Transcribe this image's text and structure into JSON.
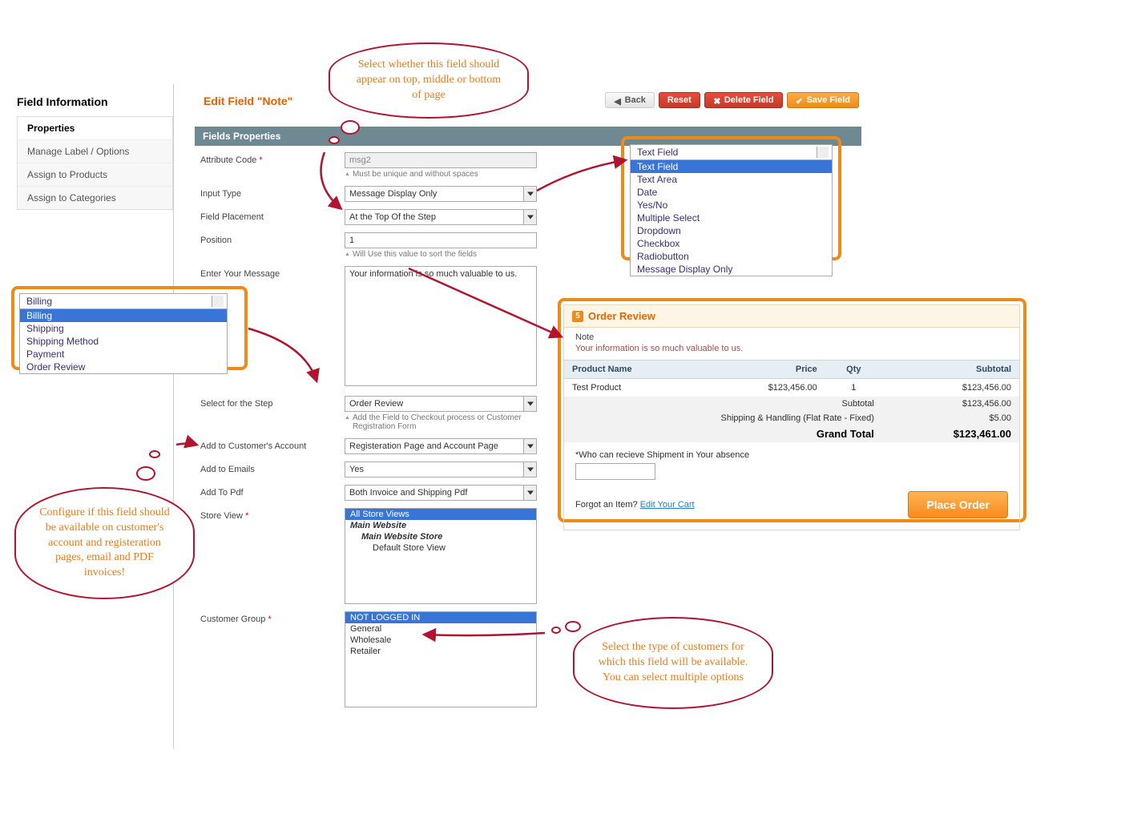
{
  "sidebar": {
    "title": "Field Information",
    "items": [
      {
        "label": "Properties",
        "active": true
      },
      {
        "label": "Manage Label / Options"
      },
      {
        "label": "Assign to Products"
      },
      {
        "label": "Assign to Categories"
      }
    ]
  },
  "page": {
    "title": "Edit Field \"Note\""
  },
  "toolbar": {
    "back": "Back",
    "reset": "Reset",
    "delete": "Delete Field",
    "save": "Save Field"
  },
  "panel": {
    "title": "Fields Properties"
  },
  "form": {
    "attribute_code": {
      "label": "Attribute Code",
      "value": "msg2",
      "hint": "Must be unique and without spaces"
    },
    "input_type": {
      "label": "Input Type",
      "value": "Message Display Only"
    },
    "field_placement": {
      "label": "Field Placement",
      "value": "At the Top Of the Step"
    },
    "position": {
      "label": "Position",
      "value": "1",
      "hint": "Will Use this value to sort the fields"
    },
    "message": {
      "label": "Enter Your Message",
      "value": "Your information is so much valuable to us."
    },
    "select_step": {
      "label": "Select for the Step",
      "value": "Order Review",
      "hint": "Add the Field to Checkout process or Customer Registration Form"
    },
    "add_account": {
      "label": "Add to Customer's Account",
      "value": "Registeration Page and Account Page"
    },
    "add_emails": {
      "label": "Add to Emails",
      "value": "Yes"
    },
    "add_pdf": {
      "label": "Add To Pdf",
      "value": "Both Invoice and Shipping Pdf"
    },
    "store_view": {
      "label": "Store View",
      "options": [
        {
          "label": "All Store Views",
          "selected": true
        },
        {
          "label": "Main Website",
          "level": 1
        },
        {
          "label": "Main Website Store",
          "level": 2
        },
        {
          "label": "Default Store View",
          "level": 3
        }
      ]
    },
    "customer_group": {
      "label": "Customer Group",
      "options": [
        {
          "label": "NOT LOGGED IN",
          "selected": true
        },
        {
          "label": "General"
        },
        {
          "label": "Wholesale"
        },
        {
          "label": "Retailer"
        }
      ]
    }
  },
  "callouts": {
    "placement": "Select whether this field should appear on top, middle or bottom of page",
    "account": "Configure if this field should be available on customer's account and registeration pages, email and PDF invoices!",
    "group": "Select the type of customers for which this field will be available. You can select multiple options"
  },
  "input_type_popup": {
    "head": "Text Field",
    "options": [
      "Text Field",
      "Text Area",
      "Date",
      "Yes/No",
      "Multiple Select",
      "Dropdown",
      "Checkbox",
      "Radiobutton",
      "Message Display Only"
    ]
  },
  "step_popup": {
    "head": "Billing",
    "options": [
      "Billing",
      "Shipping",
      "Shipping Method",
      "Payment",
      "Order Review"
    ]
  },
  "order": {
    "title": "Order Review",
    "note_label": "Note",
    "note_text": "Your information is so much valuable to us.",
    "cols": {
      "name": "Product Name",
      "price": "Price",
      "qty": "Qty",
      "subtotal": "Subtotal"
    },
    "rows": [
      {
        "name": "Test Product",
        "price": "$123,456.00",
        "qty": "1",
        "subtotal": "$123,456.00"
      }
    ],
    "totals": {
      "subtotal_label": "Subtotal",
      "subtotal": "$123,456.00",
      "ship_label": "Shipping & Handling (Flat Rate - Fixed)",
      "ship": "$5.00",
      "grand_label": "Grand Total",
      "grand": "$123,461.00"
    },
    "question": "*Who can recieve Shipment in Your absence",
    "forgot": "Forgot an Item?",
    "editcart": "Edit Your Cart",
    "place": "Place Order"
  }
}
